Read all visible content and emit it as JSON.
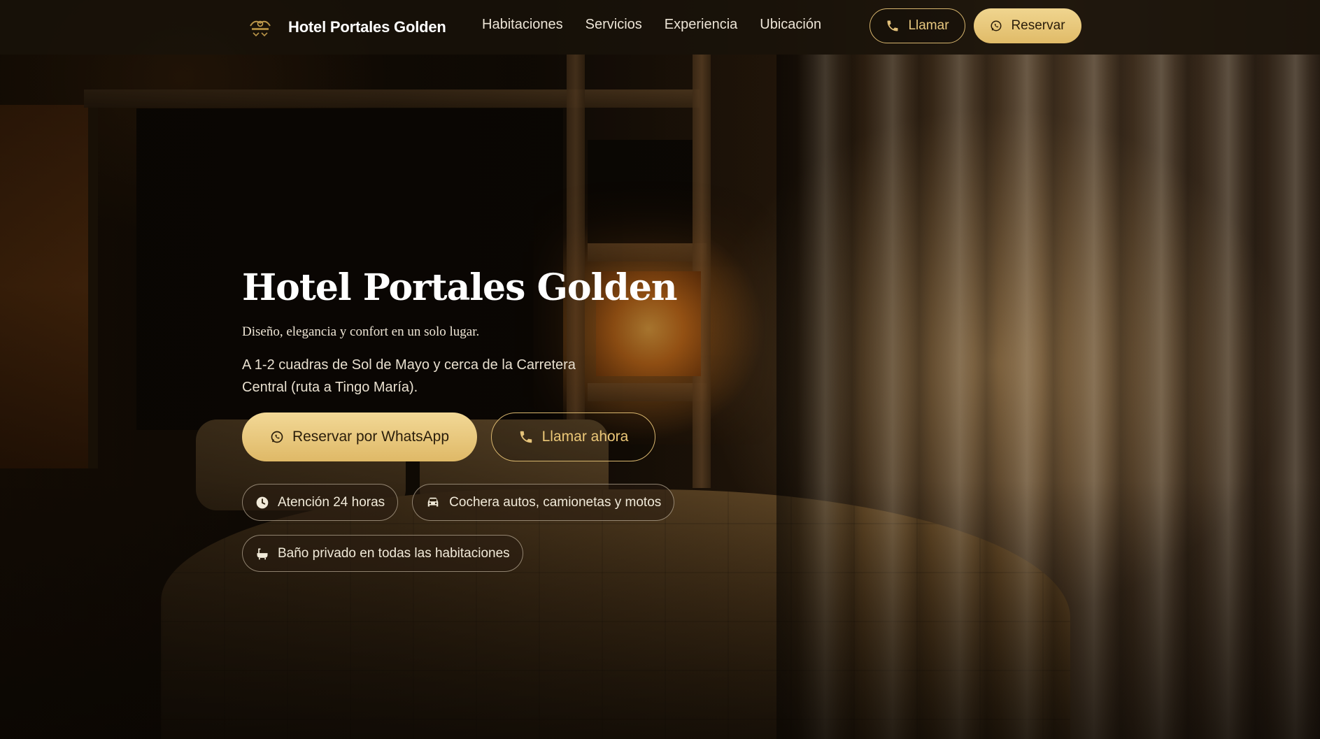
{
  "header": {
    "brand_name": "Hotel Portales Golden",
    "logo_icon": "hotel-crest-logo",
    "nav": [
      {
        "label": "Habitaciones"
      },
      {
        "label": "Servicios"
      },
      {
        "label": "Experiencia"
      },
      {
        "label": "Ubicación"
      }
    ],
    "call_label": "Llamar",
    "book_label": "Reservar"
  },
  "hero": {
    "title": "Hotel Portales Golden",
    "tagline": "Diseño, elegancia y confort en un solo lugar.",
    "location": "A 1-2 cuadras de Sol de Mayo y cerca de la Carretera Central (ruta a Tingo María).",
    "cta_whatsapp": "Reservar por WhatsApp",
    "cta_call": "Llamar ahora",
    "features": [
      {
        "label": "Atención 24 horas",
        "icon": "clock-icon"
      },
      {
        "label": "Cochera autos, camionetas y motos",
        "icon": "car-icon"
      },
      {
        "label": "Baño privado en todas las habitaciones",
        "icon": "bathtub-icon"
      }
    ]
  },
  "colors": {
    "gold": "#e0bb68",
    "gold_light": "#f2d896",
    "header_bg": "#18120a",
    "text_light": "#ffffff"
  }
}
